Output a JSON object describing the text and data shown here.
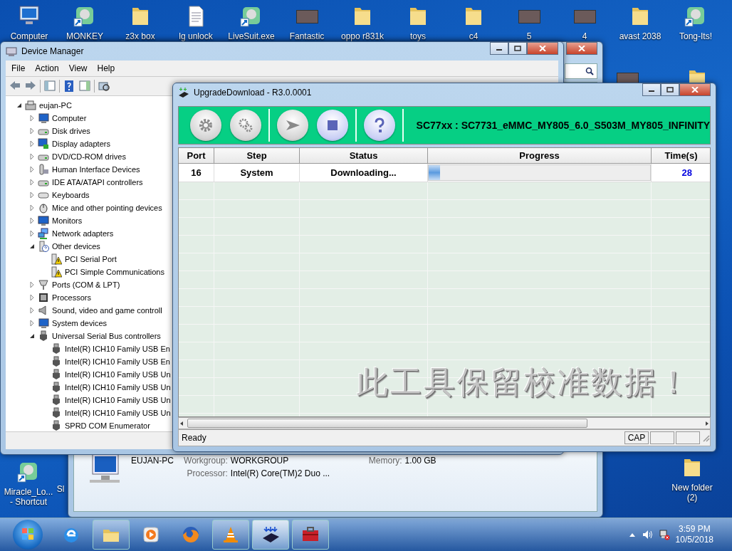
{
  "desktop_icons": [
    {
      "label": "Computer",
      "kind": "computer"
    },
    {
      "label": "MONKEY",
      "kind": "app"
    },
    {
      "label": "z3x box",
      "kind": "folder"
    },
    {
      "label": "lg unlock",
      "kind": "document"
    },
    {
      "label": "LiveSuit.exe",
      "kind": "app"
    },
    {
      "label": "Fantastic",
      "kind": "photo"
    },
    {
      "label": "oppo r831k",
      "kind": "folder"
    },
    {
      "label": "toys",
      "kind": "folder"
    },
    {
      "label": "c4",
      "kind": "folder"
    },
    {
      "label": "5",
      "kind": "photo"
    },
    {
      "label": "4",
      "kind": "photo"
    },
    {
      "label": "avast 2038",
      "kind": "folder"
    },
    {
      "label": "Tong-Its!",
      "kind": "app"
    }
  ],
  "side_icons": [
    {
      "kind": "photo"
    },
    {
      "kind": "folder"
    }
  ],
  "bottom_icons": [
    {
      "lines": [
        "Miracle_Lo...",
        "- Shortcut"
      ],
      "kind": "app"
    },
    {
      "lines": [
        "Sl"
      ],
      "kind": "none"
    },
    {
      "lines": [
        "New folder",
        "(2)"
      ],
      "kind": "folder"
    }
  ],
  "back_window": {
    "details": {
      "computer_name": "EUJAN-PC",
      "fields": [
        {
          "label": "Workgroup:",
          "value": "WORKGROUP"
        },
        {
          "label": "Memory:",
          "value": "1.00 GB"
        },
        {
          "label": "Processor:",
          "value": "Intel(R) Core(TM)2 Duo ..."
        }
      ]
    }
  },
  "device_manager": {
    "title": "Device Manager",
    "menu": [
      "File",
      "Action",
      "View",
      "Help"
    ],
    "tree": [
      {
        "label": "eujan-PC",
        "kind": "root",
        "expanded": true,
        "children": [
          {
            "label": "Computer",
            "kind": "computer",
            "expanded": false
          },
          {
            "label": "Disk drives",
            "kind": "disk",
            "expanded": false
          },
          {
            "label": "Display adapters",
            "kind": "display",
            "expanded": false
          },
          {
            "label": "DVD/CD-ROM drives",
            "kind": "disk",
            "expanded": false
          },
          {
            "label": "Human Interface Devices",
            "kind": "hid",
            "expanded": false
          },
          {
            "label": "IDE ATA/ATAPI controllers",
            "kind": "disk",
            "expanded": false
          },
          {
            "label": "Keyboards",
            "kind": "keyboard",
            "expanded": false
          },
          {
            "label": "Mice and other pointing devices",
            "kind": "mouse",
            "expanded": false
          },
          {
            "label": "Monitors",
            "kind": "monitor",
            "expanded": false
          },
          {
            "label": "Network adapters",
            "kind": "network",
            "expanded": false
          },
          {
            "label": "Other devices",
            "kind": "unknown",
            "expanded": true,
            "children": [
              {
                "label": "PCI Serial Port",
                "kind": "warning"
              },
              {
                "label": "PCI Simple Communications",
                "kind": "warning"
              }
            ]
          },
          {
            "label": "Ports (COM & LPT)",
            "kind": "port",
            "expanded": false
          },
          {
            "label": "Processors",
            "kind": "processor",
            "expanded": false
          },
          {
            "label": "Sound, video and game controll",
            "kind": "sound",
            "expanded": false
          },
          {
            "label": "System devices",
            "kind": "computer",
            "expanded": false
          },
          {
            "label": "Universal Serial Bus controllers",
            "kind": "usb",
            "expanded": true,
            "children": [
              {
                "label": "Intel(R) ICH10 Family USB En",
                "kind": "usb"
              },
              {
                "label": "Intel(R) ICH10 Family USB En",
                "kind": "usb"
              },
              {
                "label": "Intel(R) ICH10 Family USB Un",
                "kind": "usb"
              },
              {
                "label": "Intel(R) ICH10 Family USB Un",
                "kind": "usb"
              },
              {
                "label": "Intel(R) ICH10 Family USB Un",
                "kind": "usb"
              },
              {
                "label": "Intel(R) ICH10 Family USB Un",
                "kind": "usb"
              },
              {
                "label": "SPRD COM Enumerator",
                "kind": "usb"
              }
            ]
          }
        ]
      }
    ]
  },
  "upgrade_window": {
    "title": "UpgradeDownload - R3.0.0001",
    "toolbar": [
      {
        "kind": "gear",
        "disabled": true,
        "separator_after": false
      },
      {
        "kind": "gears",
        "disabled": true,
        "separator_after": true
      },
      {
        "kind": "play",
        "disabled": true,
        "separator_after": false
      },
      {
        "kind": "stop",
        "disabled": false,
        "separator_after": true
      },
      {
        "kind": "help",
        "disabled": false,
        "separator_after": true
      }
    ],
    "product": "SC77xx : SC7731_eMMC_MY805_6.0_S503M_MY805_INFINITY",
    "table": {
      "columns": [
        "Port",
        "Step",
        "Status",
        "Progress",
        "Time(s)"
      ],
      "rows": [
        {
          "port": "16",
          "step": "System",
          "status": "Downloading...",
          "level": 0.05,
          "time": "28"
        }
      ]
    },
    "overlay_text": "此工具保留校准数据！",
    "status_bar": {
      "message": "Ready",
      "indicators": [
        "CAP"
      ]
    }
  },
  "taskbar": {
    "items": [
      {
        "kind": "ie",
        "running": false,
        "selected": false
      },
      {
        "kind": "explorer",
        "running": true,
        "selected": false
      },
      {
        "kind": "media",
        "running": false,
        "selected": false
      },
      {
        "kind": "firefox",
        "running": false,
        "selected": false
      },
      {
        "kind": "vlc",
        "running": true,
        "selected": false
      },
      {
        "kind": "download",
        "running": true,
        "selected": true
      },
      {
        "kind": "toolbox",
        "running": true,
        "selected": false
      }
    ],
    "time": "3:59 PM",
    "date": "10/5/2018"
  }
}
